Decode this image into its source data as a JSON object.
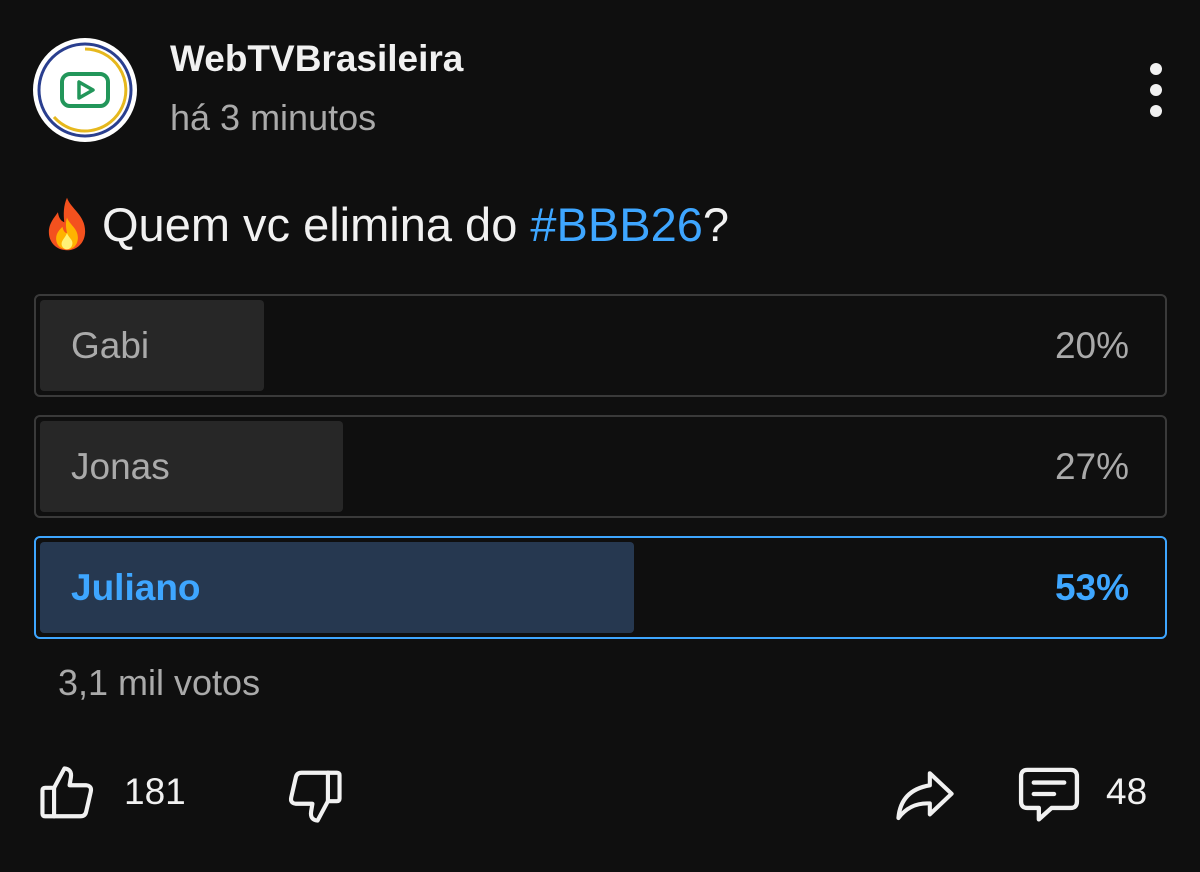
{
  "post": {
    "channel_name": "WebTVBrasileira",
    "timestamp": "há 3 minutos",
    "question_prefix": "Quem vc elimina do ",
    "hashtag": "#BBB26",
    "question_suffix": "?",
    "fire_emoji": "🔥"
  },
  "poll": {
    "options": [
      {
        "label": "Gabi",
        "percent_text": "20%",
        "percent": 20,
        "selected": false
      },
      {
        "label": "Jonas",
        "percent_text": "27%",
        "percent": 27,
        "selected": false
      },
      {
        "label": "Juliano",
        "percent_text": "53%",
        "percent": 53,
        "selected": true
      }
    ],
    "votes": "3,1 mil votos"
  },
  "actions": {
    "likes": "181",
    "comments": "48"
  },
  "icons": {
    "avatar": "play-icon",
    "menu": "more-vertical-icon",
    "like": "thumbs-up-icon",
    "dislike": "thumbs-down-icon",
    "share": "share-icon",
    "comment": "comment-icon"
  },
  "colors": {
    "background": "#0f0f0f",
    "accent": "#3ea6ff",
    "selected_fill": "#263850",
    "unselected_fill": "#272727",
    "text_secondary": "#aaaaaa"
  }
}
